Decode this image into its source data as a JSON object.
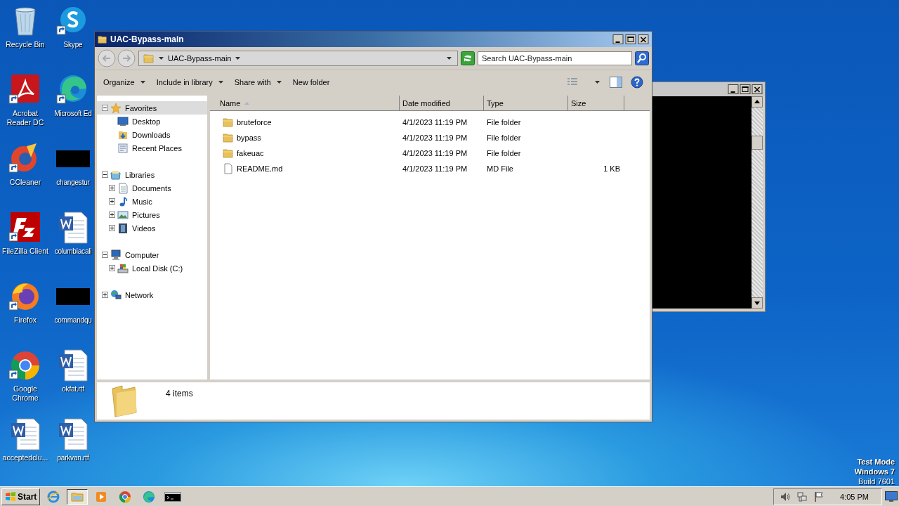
{
  "desktop_icons": [
    {
      "label": "Recycle Bin",
      "kind": "recycle",
      "shortcut": false
    },
    {
      "label": "Skype",
      "kind": "skype",
      "shortcut": true
    },
    {
      "label": "Acrobat Reader DC",
      "kind": "acrobat",
      "shortcut": true
    },
    {
      "label": "Microsoft Ed",
      "kind": "edge",
      "shortcut": true
    },
    {
      "label": "CCleaner",
      "kind": "ccleaner",
      "shortcut": true
    },
    {
      "label": "changestur",
      "kind": "redacted",
      "shortcut": false
    },
    {
      "label": "FileZilla Client",
      "kind": "filezilla",
      "shortcut": true
    },
    {
      "label": "columbiacali",
      "kind": "word",
      "shortcut": false
    },
    {
      "label": "Firefox",
      "kind": "firefox",
      "shortcut": true
    },
    {
      "label": "commandqu",
      "kind": "redacted",
      "shortcut": false
    },
    {
      "label": "Google Chrome",
      "kind": "chrome",
      "shortcut": true
    },
    {
      "label": "okfat.rtf",
      "kind": "word",
      "shortcut": false
    },
    {
      "label": "acceptedclu...",
      "kind": "word",
      "shortcut": false
    },
    {
      "label": "parkvan.rtf",
      "kind": "word",
      "shortcut": false
    }
  ],
  "explorer": {
    "title": "UAC-Bypass-main",
    "address": "UAC-Bypass-main",
    "search": {
      "placeholder": "Search UAC-Bypass-main"
    },
    "toolbar": [
      {
        "label": "Organize",
        "dropdown": true
      },
      {
        "label": "Include in library",
        "dropdown": true
      },
      {
        "label": "Share with",
        "dropdown": true
      },
      {
        "label": "New folder",
        "dropdown": false
      }
    ],
    "nav": [
      {
        "label": "Favorites",
        "kind": "star",
        "expanded": true,
        "selected": true,
        "children": [
          {
            "label": "Desktop",
            "kind": "desktop",
            "selected": false
          },
          {
            "label": "Downloads",
            "kind": "downloads",
            "selected": false
          },
          {
            "label": "Recent Places",
            "kind": "recent",
            "selected": false
          }
        ]
      },
      {
        "label": "Libraries",
        "kind": "library",
        "expanded": true,
        "selected": false,
        "children": [
          {
            "label": "Documents",
            "kind": "documents",
            "expanded": false,
            "selected": false
          },
          {
            "label": "Music",
            "kind": "music",
            "expanded": false,
            "selected": false
          },
          {
            "label": "Pictures",
            "kind": "pictures",
            "expanded": false,
            "selected": false
          },
          {
            "label": "Videos",
            "kind": "videos",
            "expanded": false,
            "selected": false
          }
        ]
      },
      {
        "label": "Computer",
        "kind": "computer",
        "expanded": true,
        "selected": false,
        "children": [
          {
            "label": "Local Disk (C:)",
            "kind": "disk",
            "expanded": false,
            "selected": false
          }
        ]
      },
      {
        "label": "Network",
        "kind": "network",
        "expanded": false,
        "selected": false
      }
    ],
    "columns": [
      {
        "label": "Name",
        "sorted": true
      },
      {
        "label": "Date modified",
        "sorted": false
      },
      {
        "label": "Type",
        "sorted": false
      },
      {
        "label": "Size",
        "sorted": false
      }
    ],
    "rows": [
      {
        "name": "bruteforce",
        "date": "4/1/2023 11:19 PM",
        "type": "File folder",
        "kind": "folder"
      },
      {
        "name": "bypass",
        "date": "4/1/2023 11:19 PM",
        "type": "File folder",
        "kind": "folder"
      },
      {
        "name": "fakeuac",
        "date": "4/1/2023 11:19 PM",
        "type": "File folder",
        "kind": "folder"
      },
      {
        "name": "README.md",
        "date": "4/1/2023 11:19 PM",
        "type": "MD File",
        "size": "1 KB",
        "kind": "file"
      }
    ],
    "status": "4 items"
  },
  "desktop_info": [
    "Test Mode",
    "Windows 7",
    "Build 7601"
  ],
  "taskbar": {
    "start": "Start",
    "apps": [
      {
        "kind": "ie",
        "selected": false
      },
      {
        "kind": "explorer",
        "selected": true
      },
      {
        "kind": "media",
        "selected": false
      },
      {
        "kind": "chrome",
        "selected": false
      },
      {
        "kind": "edge",
        "selected": false
      },
      {
        "kind": "console",
        "selected": false
      }
    ],
    "clock": "4:05 PM"
  }
}
